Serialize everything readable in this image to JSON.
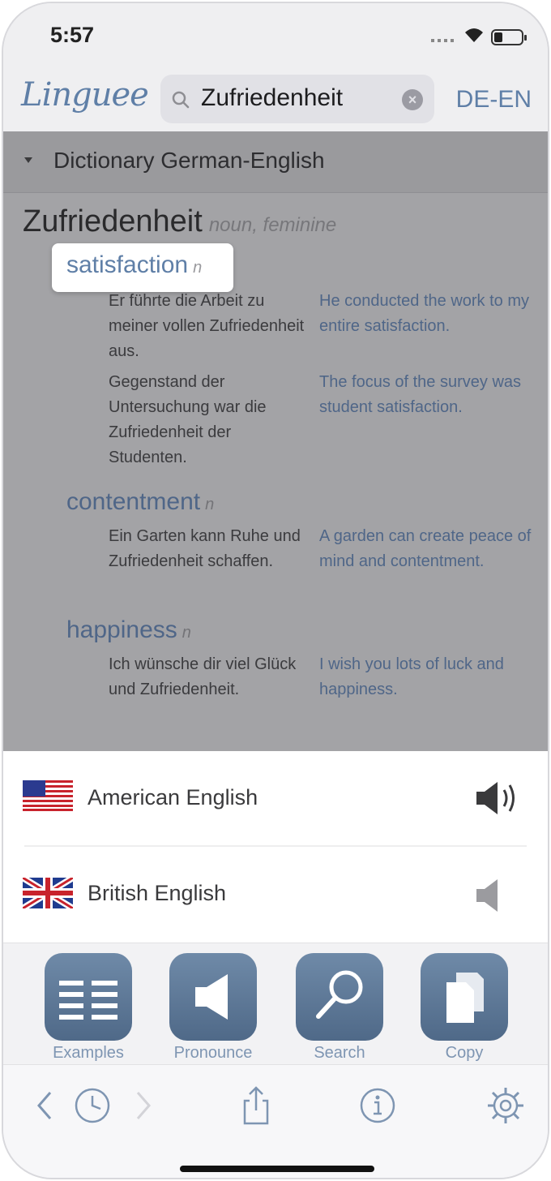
{
  "status_bar": {
    "time": "5:57"
  },
  "nav": {
    "logo": "Linguee",
    "search_query": "Zufriedenheit",
    "language_pair": "DE-EN"
  },
  "dictionary": {
    "section_title": "Dictionary German-English",
    "headword": "Zufriedenheit",
    "headword_grammar": "noun, feminine",
    "entries": [
      {
        "term": "satisfaction",
        "pos": "n",
        "examples": [
          {
            "de": "Er führte die Arbeit zu meiner vollen Zufriedenheit aus.",
            "en": "He conducted the work to my entire satisfaction."
          },
          {
            "de": "Gegenstand der Untersuchung war die Zufriedenheit der Studenten.",
            "en": "The focus of the survey was student satisfaction."
          }
        ]
      },
      {
        "term": "contentment",
        "pos": "n",
        "examples": [
          {
            "de": "Ein Garten kann Ruhe und Zufriedenheit schaffen.",
            "en": "A garden can create peace of mind and contentment."
          }
        ]
      },
      {
        "term": "happiness",
        "pos": "n",
        "examples": [
          {
            "de": "Ich wünsche dir viel Glück und Zufriedenheit.",
            "en": "I wish you lots of luck and happiness."
          }
        ]
      }
    ]
  },
  "pronunciation": [
    {
      "label": "American English",
      "icon": "us-flag-icon",
      "speaker_color": "#3a3a3c"
    },
    {
      "label": "British English",
      "icon": "uk-flag-icon",
      "speaker_color": "#9b9b9f"
    }
  ],
  "actions": [
    {
      "label": "Examples",
      "icon": "list-icon"
    },
    {
      "label": "Pronounce",
      "icon": "speaker-icon"
    },
    {
      "label": "Search",
      "icon": "magnifier-icon"
    },
    {
      "label": "Copy",
      "icon": "copy-icon"
    }
  ],
  "toolbar": {
    "icons": [
      "back-chevron-icon",
      "history-clock-icon",
      "forward-chevron-icon",
      "share-icon",
      "info-icon",
      "settings-gear-icon"
    ]
  },
  "colors": {
    "accent": "#5f7fa7",
    "dim_overlay": "#a3a3a6",
    "tile": "#5b7694"
  }
}
